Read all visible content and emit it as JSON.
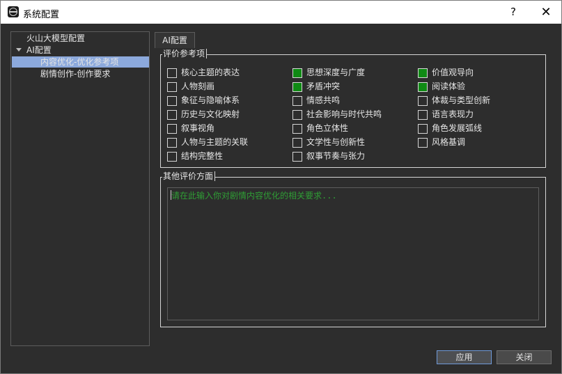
{
  "window": {
    "title": "系统配置",
    "help_label": "?",
    "close_label": "✕"
  },
  "tree": {
    "items": [
      {
        "label": "火山大模型配置"
      },
      {
        "label": "AI配置",
        "expanded": true
      },
      {
        "label": "内容优化-优化参考项",
        "selected": true
      },
      {
        "label": "剧情创作-创作要求"
      }
    ]
  },
  "tab": {
    "label": "AI配置"
  },
  "criteria": {
    "title": "评价参考项",
    "items": [
      {
        "label": "核心主题的表达",
        "checked": false
      },
      {
        "label": "人物刻画",
        "checked": false
      },
      {
        "label": "象征与隐喻体系",
        "checked": false
      },
      {
        "label": "历史与文化映射",
        "checked": false
      },
      {
        "label": "叙事视角",
        "checked": false
      },
      {
        "label": "人物与主题的关联",
        "checked": false
      },
      {
        "label": "结构完整性",
        "checked": false
      },
      {
        "label": "思想深度与广度",
        "checked": true
      },
      {
        "label": "矛盾冲突",
        "checked": true
      },
      {
        "label": "情感共鸣",
        "checked": false
      },
      {
        "label": "社会影响与时代共鸣",
        "checked": false
      },
      {
        "label": "角色立体性",
        "checked": false
      },
      {
        "label": "文学性与创新性",
        "checked": false
      },
      {
        "label": "叙事节奏与张力",
        "checked": false
      },
      {
        "label": "价值观导向",
        "checked": true
      },
      {
        "label": "阅读体验",
        "checked": true
      },
      {
        "label": "体裁与类型创新",
        "checked": false
      },
      {
        "label": "语言表现力",
        "checked": false
      },
      {
        "label": "角色发展弧线",
        "checked": false
      },
      {
        "label": "风格基调",
        "checked": false
      }
    ]
  },
  "other": {
    "title": "其他评价方面",
    "placeholder": "请在此输入你对剧情内容优化的相关要求...",
    "value": ""
  },
  "buttons": {
    "apply_label": "应用",
    "close_label": "关闭"
  },
  "colors": {
    "accent_selection": "#8ca9dc",
    "checked": "#0f8a14",
    "placeholder": "#2f9e35"
  }
}
